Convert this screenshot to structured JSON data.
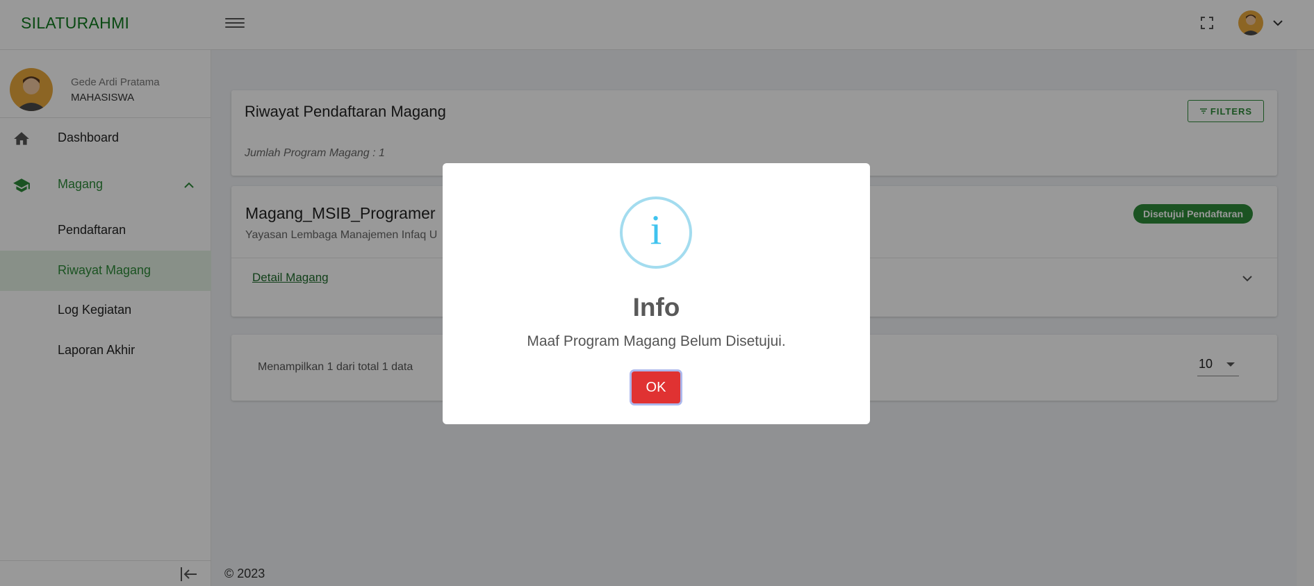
{
  "brand": "SILATURAHMI",
  "user": {
    "name": "Gede Ardi Pratama",
    "role": "MAHASISWA"
  },
  "sidebar": {
    "items": [
      {
        "label": "Dashboard",
        "icon": "home-icon"
      },
      {
        "label": "Magang",
        "icon": "graduation-cap-icon",
        "expanded": true
      },
      {
        "label": "Pendaftaran"
      },
      {
        "label": "Riwayat Magang",
        "active": true
      },
      {
        "label": "Log Kegiatan"
      },
      {
        "label": "Laporan Akhir"
      }
    ]
  },
  "header_card": {
    "title": "Riwayat Pendaftaran Magang",
    "filters_label": "FILTERS",
    "count_text": "Jumlah Program Magang : 1"
  },
  "program": {
    "title": "Magang_MSIB_Programer",
    "organization": "Yayasan Lembaga Manajemen Infaq U",
    "status": "Disetujui Pendaftaran",
    "detail_link": "Detail Magang"
  },
  "pagination": {
    "summary": "Menampilkan 1 dari total 1 data",
    "page_size": "10"
  },
  "footer": "© 2023",
  "modal": {
    "icon_char": "i",
    "title": "Info",
    "message": "Maaf Program Magang Belum Disetujui.",
    "ok_label": "OK"
  },
  "colors": {
    "brand": "#0f7a1f",
    "accent": "#2e8b3a",
    "ok_button": "#e03232",
    "info_icon": "#3fc3ee"
  }
}
